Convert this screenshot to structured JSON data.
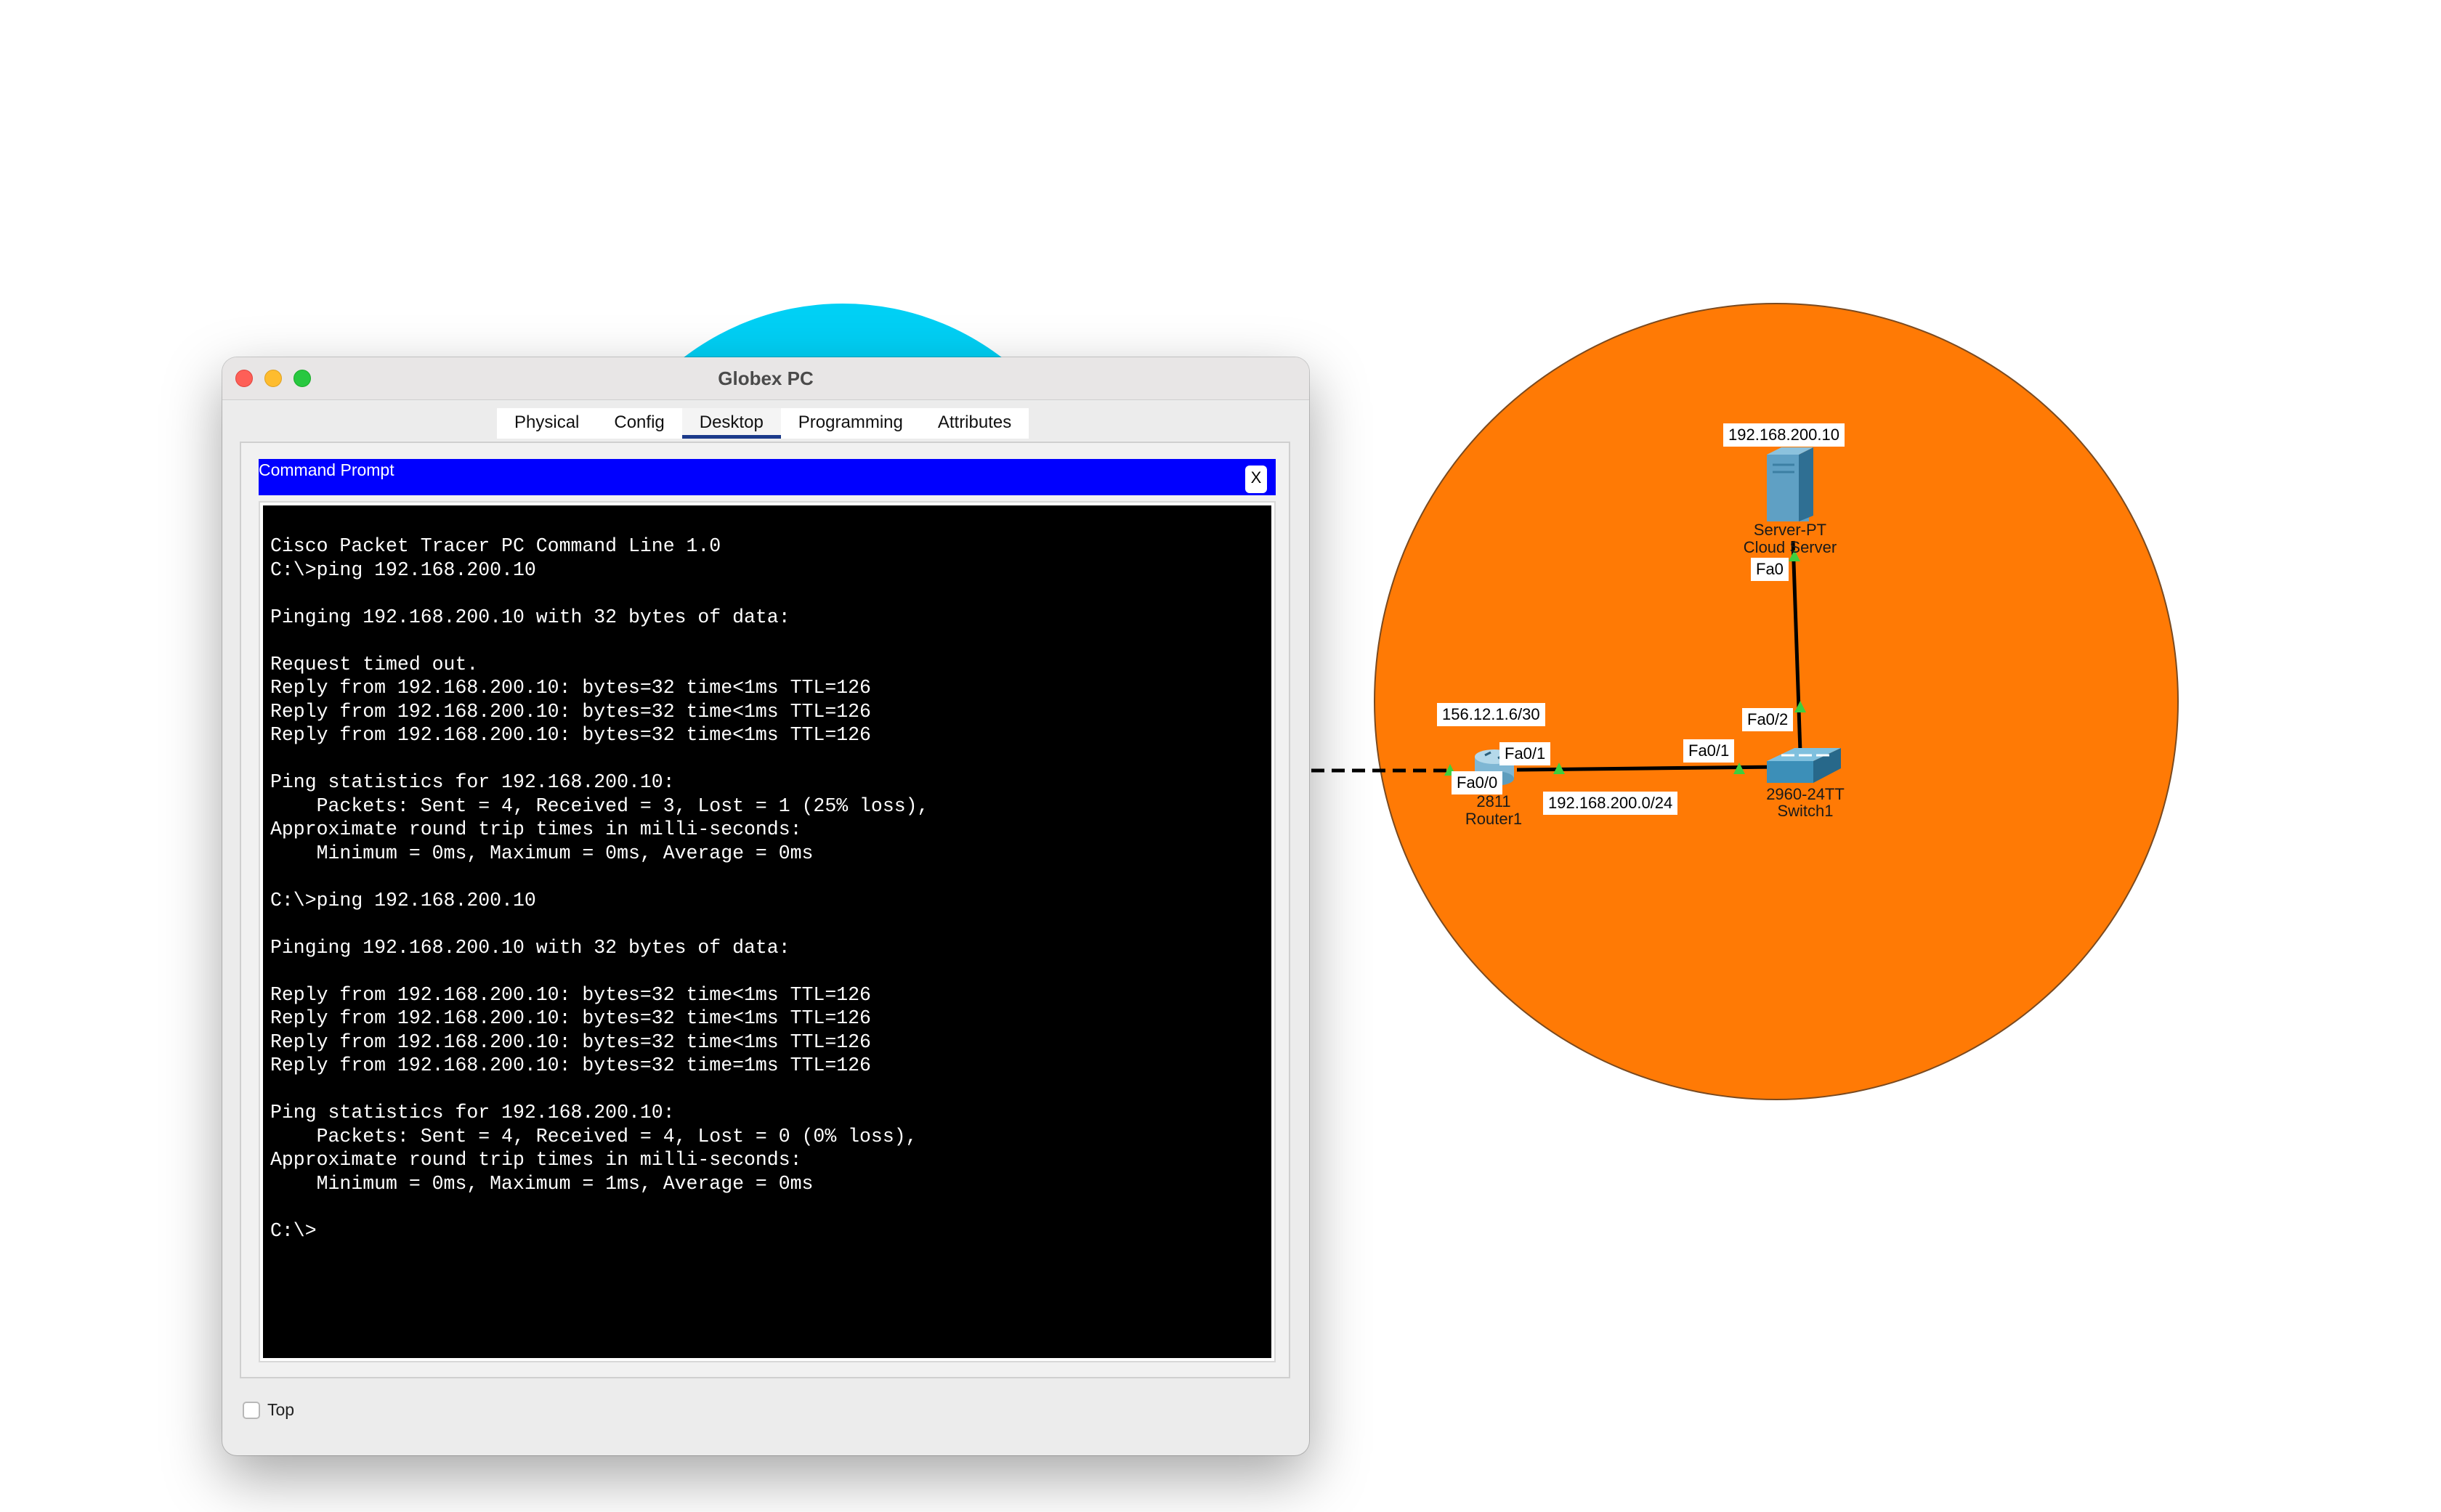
{
  "window": {
    "title": "Globex PC",
    "tabs": [
      {
        "label": "Physical",
        "active": false
      },
      {
        "label": "Config",
        "active": false
      },
      {
        "label": "Desktop",
        "active": true
      },
      {
        "label": "Programming",
        "active": false
      },
      {
        "label": "Attributes",
        "active": false
      }
    ],
    "command_prompt": {
      "title": "Command Prompt",
      "close_label": "X",
      "output": "Cisco Packet Tracer PC Command Line 1.0\nC:\\>ping 192.168.200.10\n\nPinging 192.168.200.10 with 32 bytes of data:\n\nRequest timed out.\nReply from 192.168.200.10: bytes=32 time<1ms TTL=126\nReply from 192.168.200.10: bytes=32 time<1ms TTL=126\nReply from 192.168.200.10: bytes=32 time<1ms TTL=126\n\nPing statistics for 192.168.200.10:\n    Packets: Sent = 4, Received = 3, Lost = 1 (25% loss),\nApproximate round trip times in milli-seconds:\n    Minimum = 0ms, Maximum = 0ms, Average = 0ms\n\nC:\\>ping 192.168.200.10\n\nPinging 192.168.200.10 with 32 bytes of data:\n\nReply from 192.168.200.10: bytes=32 time<1ms TTL=126\nReply from 192.168.200.10: bytes=32 time<1ms TTL=126\nReply from 192.168.200.10: bytes=32 time<1ms TTL=126\nReply from 192.168.200.10: bytes=32 time=1ms TTL=126\n\nPing statistics for 192.168.200.10:\n    Packets: Sent = 4, Received = 4, Lost = 0 (0% loss),\nApproximate round trip times in milli-seconds:\n    Minimum = 0ms, Maximum = 1ms, Average = 0ms\n\nC:\\>"
    },
    "top_checkbox": {
      "label": "Top",
      "checked": false
    }
  },
  "topology": {
    "colors": {
      "cyan_area": "#00d0f5",
      "orange_area": "#ff7a05",
      "link": "#000000",
      "port_up": "#3ecf3e"
    },
    "server": {
      "ip_label": "192.168.200.10",
      "model": "Server-PT",
      "name": "Cloud Server",
      "port": "Fa0",
      "icon": "server-icon"
    },
    "switch": {
      "model": "2960-24TT",
      "name": "Switch1",
      "port_uplink": "Fa0/2",
      "port_router": "Fa0/1",
      "icon": "switch-icon"
    },
    "router": {
      "model": "2811",
      "name": "Router1",
      "port_wan": "Fa0/0",
      "port_lan": "Fa0/1",
      "wan_ip": "156.12.1.6/30",
      "icon": "router-icon"
    },
    "lan_network": "192.168.200.0/24"
  }
}
